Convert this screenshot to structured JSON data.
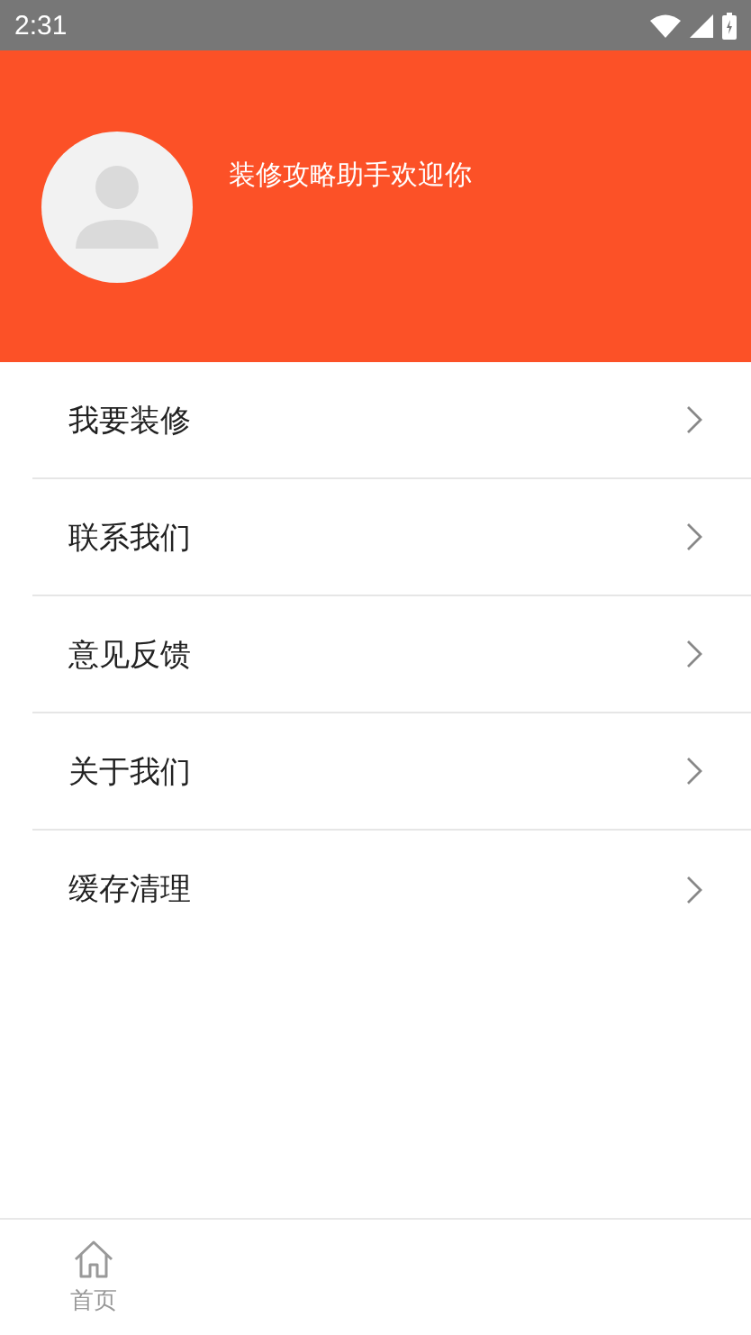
{
  "status_bar": {
    "time": "2:31"
  },
  "header": {
    "welcome": "装修攻略助手欢迎你"
  },
  "menu": [
    {
      "label": "我要装修"
    },
    {
      "label": "联系我们"
    },
    {
      "label": "意见反馈"
    },
    {
      "label": "关于我们"
    },
    {
      "label": "缓存清理"
    }
  ],
  "tab_bar": [
    {
      "label": "首页",
      "selected": false
    }
  ]
}
